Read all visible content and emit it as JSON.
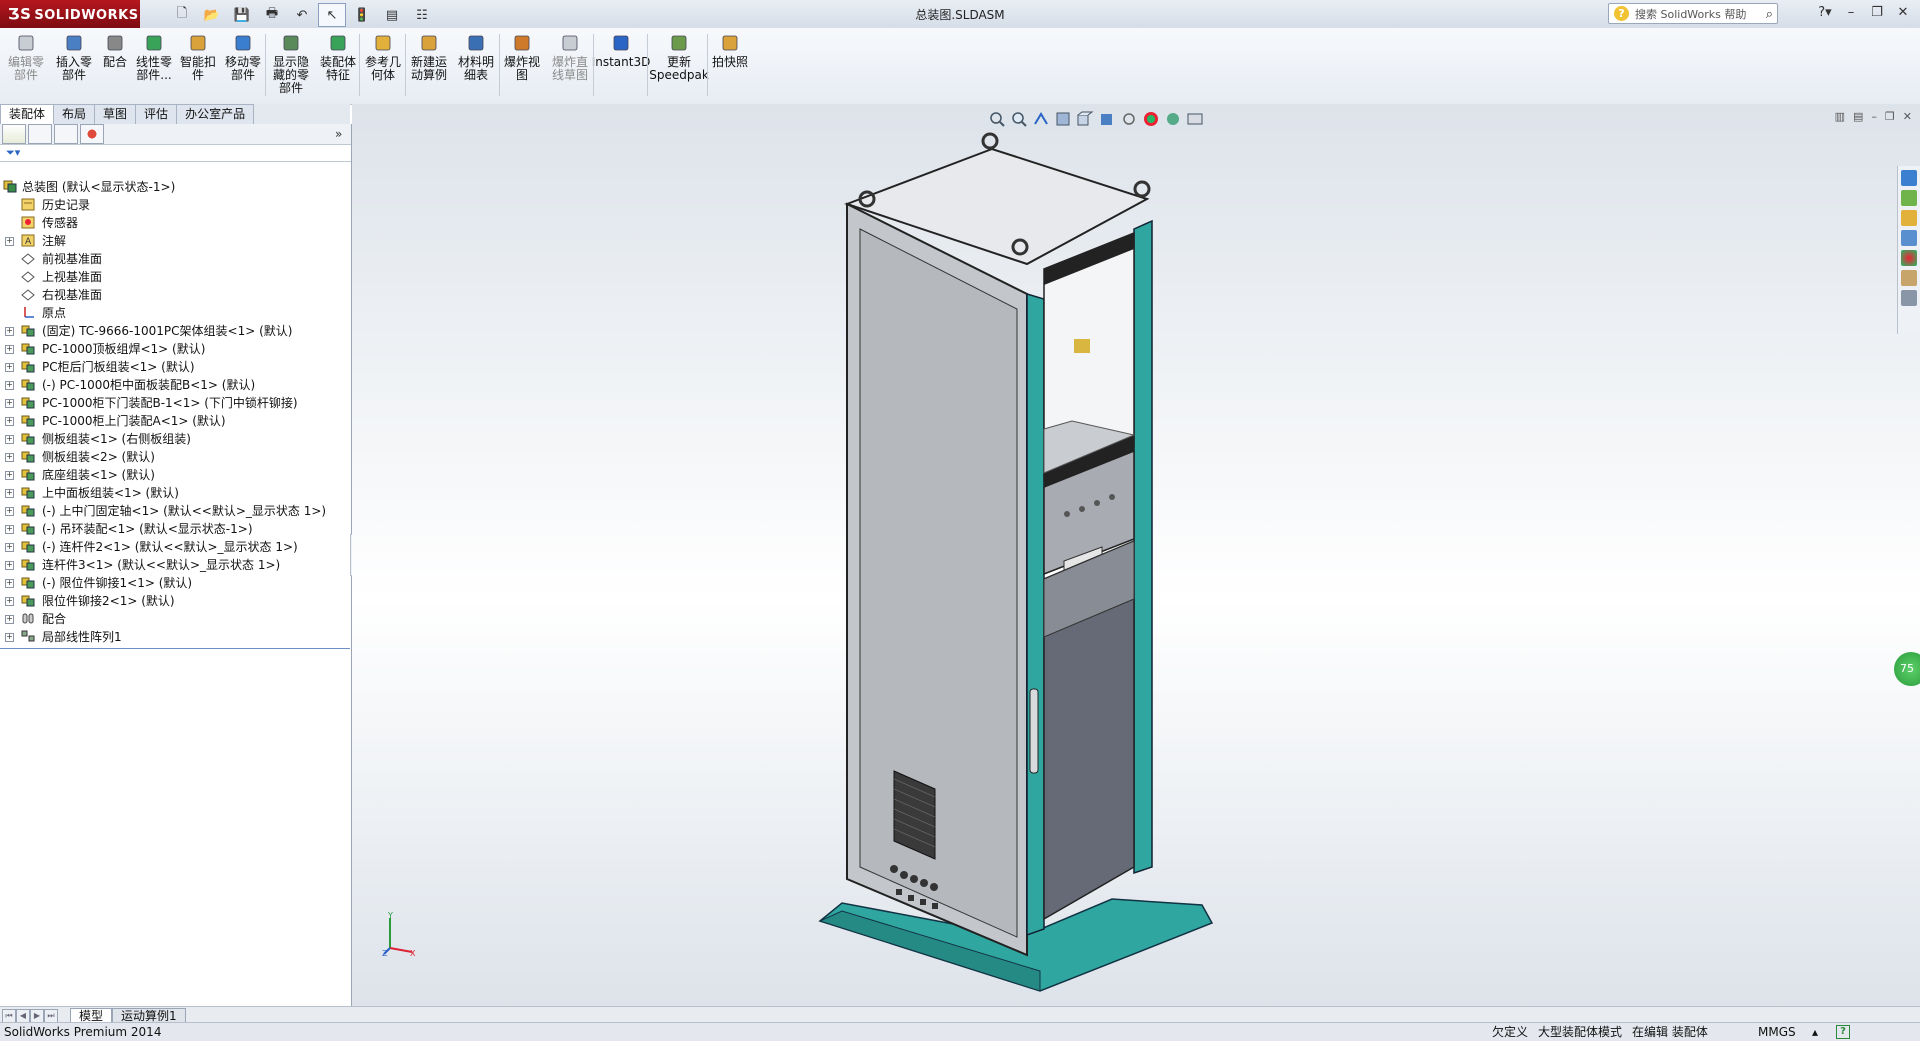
{
  "app": {
    "logo": "SOLIDWORKS",
    "title": "总装图.SLDASM"
  },
  "help_search": {
    "placeholder": "搜索 SolidWorks 帮助"
  },
  "ribbon": {
    "buttons": [
      {
        "label": "编辑零部件",
        "disabled": true
      },
      {
        "label": "插入零部件"
      },
      {
        "label": "配合"
      },
      {
        "label": "线性零部件..."
      },
      {
        "label": "智能扣件"
      },
      {
        "label": "移动零部件"
      },
      {
        "label": "显示隐藏的零部件"
      },
      {
        "label": "装配体特征"
      },
      {
        "label": "参考几何体"
      },
      {
        "label": "新建运动算例"
      },
      {
        "label": "材料明细表"
      },
      {
        "label": "爆炸视图"
      },
      {
        "label": "爆炸直线草图",
        "disabled": true
      },
      {
        "label": "Instant3D"
      },
      {
        "label": "更新Speedpak"
      },
      {
        "label": "拍快照"
      }
    ]
  },
  "command_tabs": [
    "装配体",
    "布局",
    "草图",
    "评估",
    "办公室产品"
  ],
  "tree": {
    "root": "总装图 (默认<显示状态-1>)",
    "items": [
      {
        "label": "历史记录",
        "icon": "history-icon",
        "expand": false
      },
      {
        "label": "传感器",
        "icon": "sensor-icon",
        "expand": false
      },
      {
        "label": "注解",
        "icon": "annotation-icon",
        "expand": true
      },
      {
        "label": "前视基准面",
        "icon": "plane-icon",
        "expand": false
      },
      {
        "label": "上视基准面",
        "icon": "plane-icon",
        "expand": false
      },
      {
        "label": "右视基准面",
        "icon": "plane-icon",
        "expand": false
      },
      {
        "label": "原点",
        "icon": "origin-icon",
        "expand": false
      },
      {
        "label": "(固定) TC-9666-1001PC架体组装<1> (默认)",
        "icon": "assembly-icon",
        "expand": true
      },
      {
        "label": "PC-1000顶板组焊<1> (默认)",
        "icon": "assembly-icon",
        "expand": true
      },
      {
        "label": "PC柜后门板组装<1> (默认)",
        "icon": "assembly-icon",
        "expand": true
      },
      {
        "label": "(-) PC-1000柜中面板装配B<1> (默认)",
        "icon": "assembly-icon",
        "expand": true
      },
      {
        "label": "PC-1000柜下门装配B-1<1> (下门中锁杆铆接)",
        "icon": "assembly-icon",
        "expand": true
      },
      {
        "label": "PC-1000柜上门装配A<1> (默认)",
        "icon": "assembly-icon",
        "expand": true
      },
      {
        "label": "侧板组装<1> (右侧板组装)",
        "icon": "assembly-icon",
        "expand": true
      },
      {
        "label": "侧板组装<2> (默认)",
        "icon": "assembly-icon",
        "expand": true
      },
      {
        "label": "底座组装<1> (默认)",
        "icon": "assembly-icon",
        "expand": true
      },
      {
        "label": "上中面板组装<1> (默认)",
        "icon": "assembly-icon",
        "expand": true
      },
      {
        "label": "(-) 上中门固定轴<1> (默认<<默认>_显示状态 1>)",
        "icon": "assembly-icon",
        "expand": true
      },
      {
        "label": "(-) 吊环装配<1> (默认<显示状态-1>)",
        "icon": "assembly-icon",
        "expand": true
      },
      {
        "label": "(-) 连杆件2<1> (默认<<默认>_显示状态 1>)",
        "icon": "assembly-icon",
        "expand": true
      },
      {
        "label": "连杆件3<1> (默认<<默认>_显示状态 1>)",
        "icon": "assembly-icon",
        "expand": true
      },
      {
        "label": "(-) 限位件铆接1<1> (默认)",
        "icon": "assembly-icon",
        "expand": true
      },
      {
        "label": "限位件铆接2<1> (默认)",
        "icon": "assembly-icon",
        "expand": true
      },
      {
        "label": "配合",
        "icon": "mates-icon",
        "expand": true
      },
      {
        "label": "局部线性阵列1",
        "icon": "pattern-icon",
        "expand": true
      }
    ]
  },
  "viewport": {
    "perf_badge": "75"
  },
  "bottom_tabs": [
    "模型",
    "运动算例1"
  ],
  "status": {
    "product": "SolidWorks Premium 2014",
    "state": "欠定义",
    "mode": "大型装配体模式",
    "editing": "在编辑 装配体",
    "units": "MMGS",
    "help_glyph": "?"
  },
  "colors": {
    "accent_teal": "#2fa7a0",
    "cabinet_gray": "#b9bdc2",
    "base_teal": "#3aa39a"
  }
}
